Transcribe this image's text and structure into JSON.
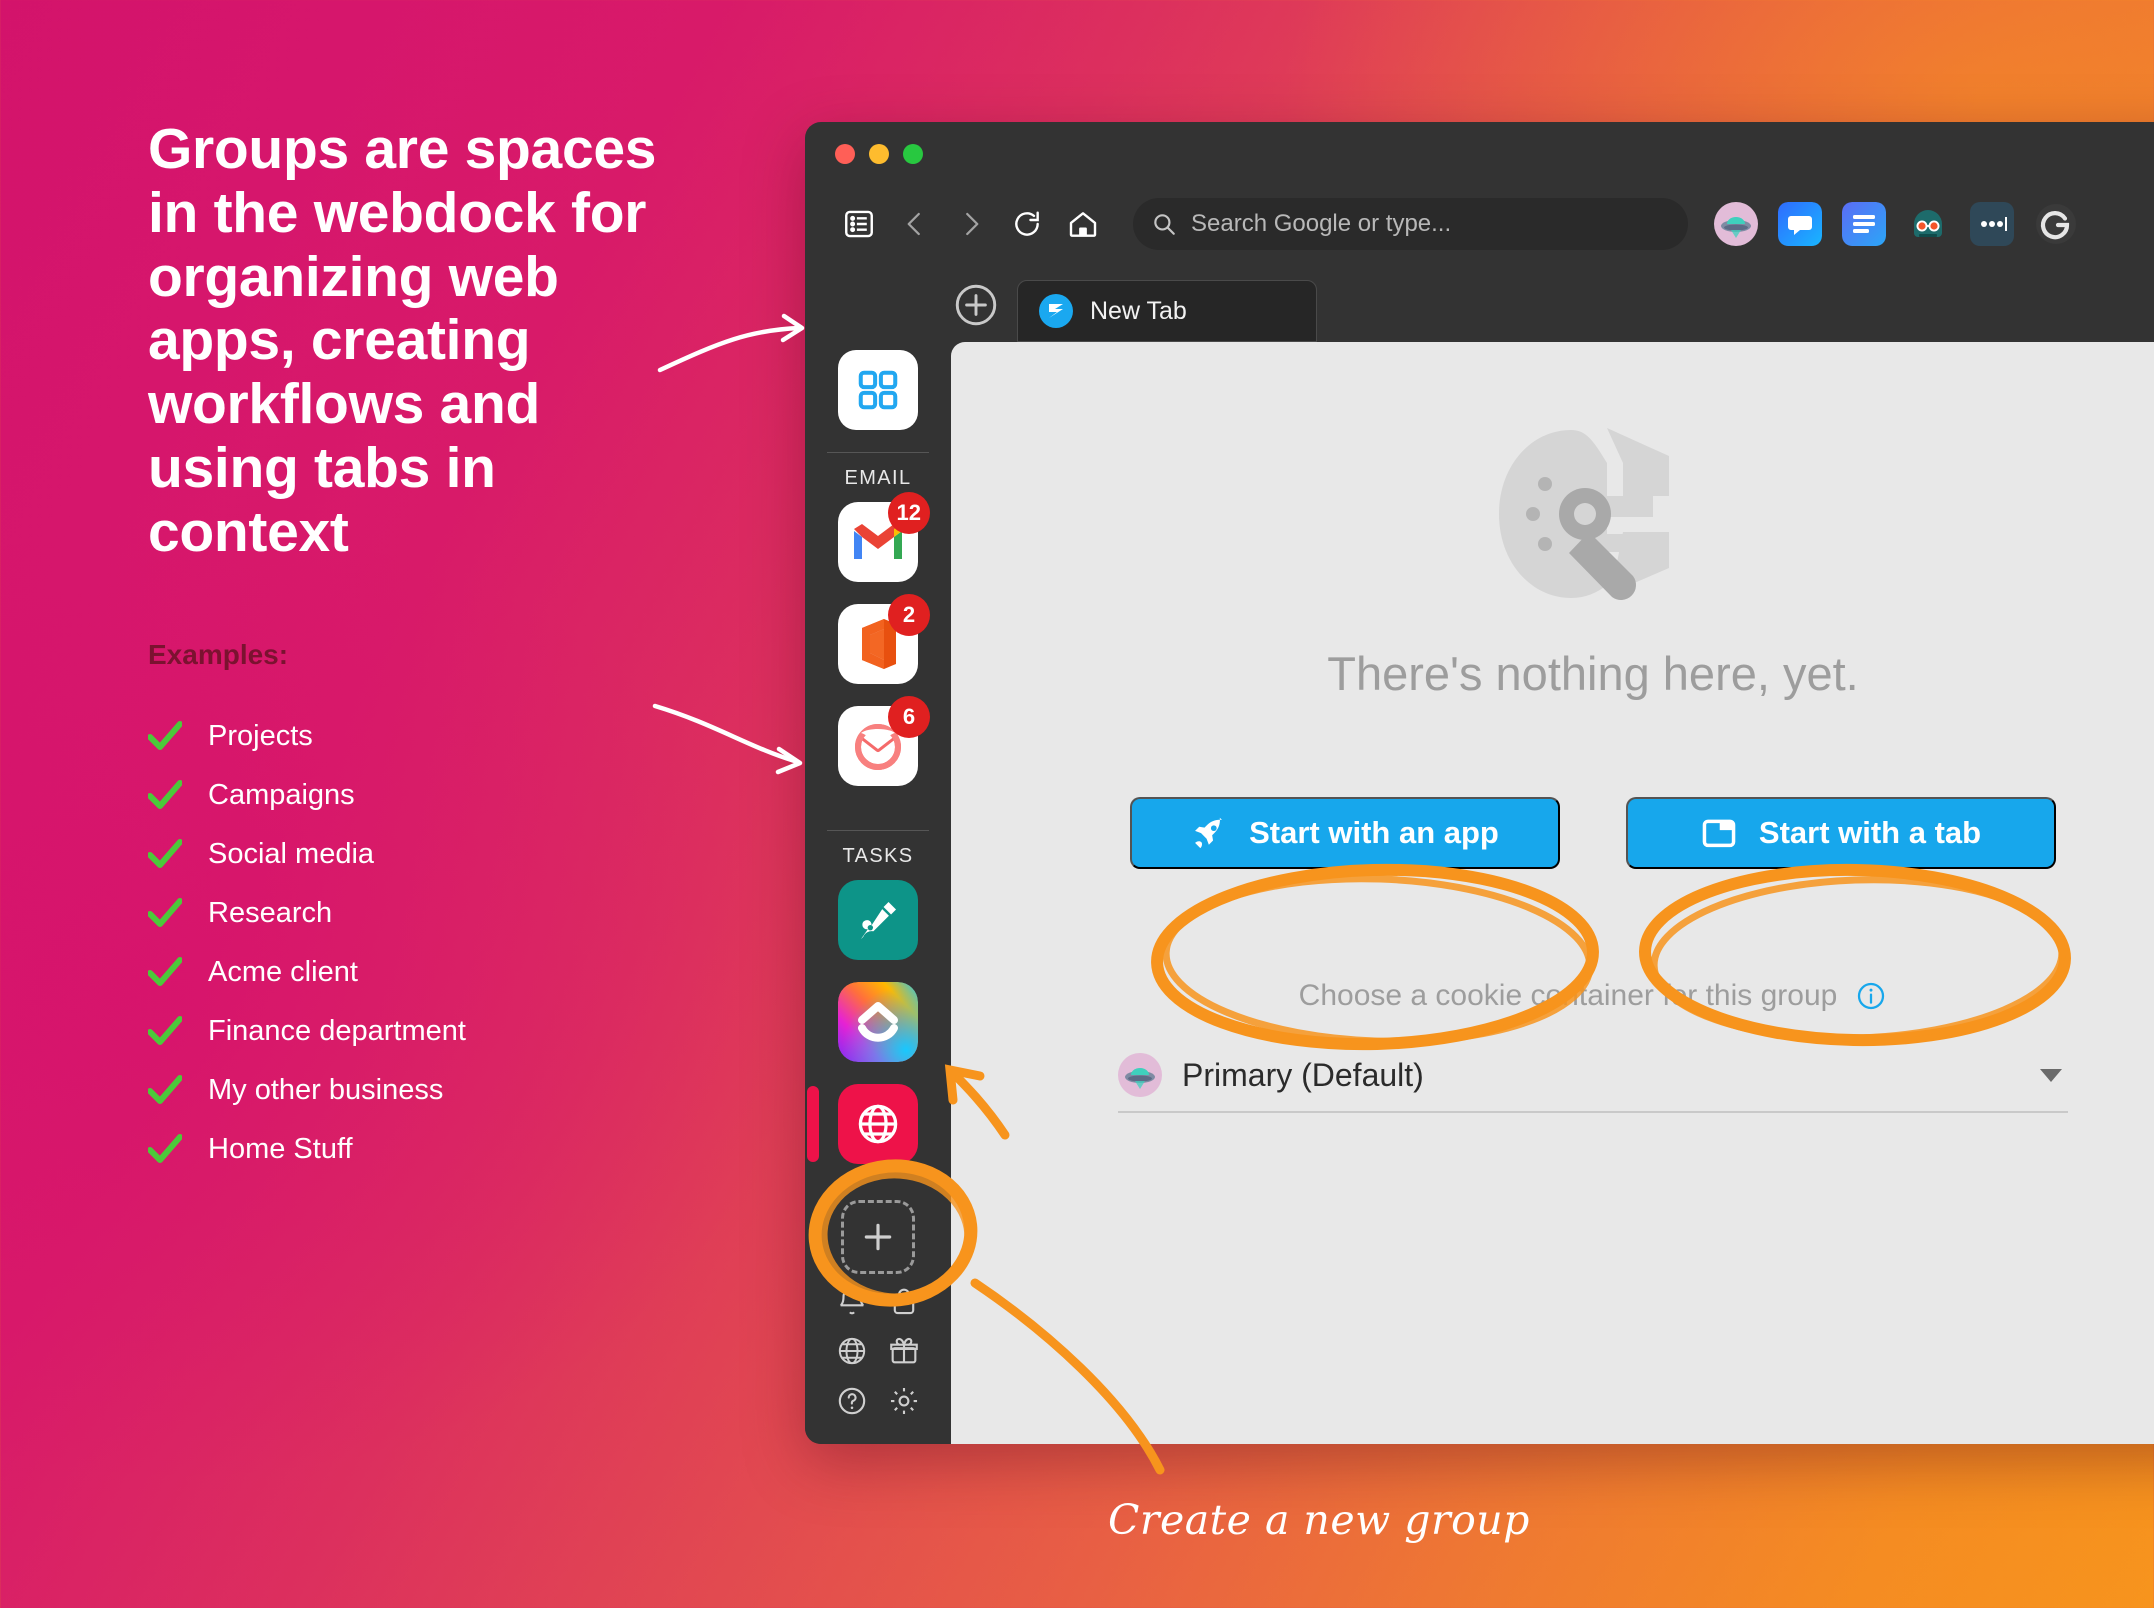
{
  "promo": {
    "headline": "Groups are spaces in the webdock for organizing web apps, creating workflows and using tabs in context",
    "examples_label": "Examples:",
    "examples": [
      "Projects",
      "Campaigns",
      "Social media",
      "Research",
      "Acme client",
      "Finance department",
      "My other business",
      "Home Stuff"
    ],
    "check_color": "#4CC93A",
    "headline_color": "#FFFFFF",
    "examples_label_color": "#7B1230"
  },
  "annotations": {
    "create_group_caption": "Create a new group",
    "highlight_color": "#F7941D"
  },
  "browser": {
    "titlebar": {
      "traffic_lights": [
        "close-button",
        "minimize-button",
        "maximize-button"
      ],
      "right_icon": "globe-icon"
    },
    "toolbar": {
      "buttons": [
        "sidebar-toggle-icon",
        "back-icon",
        "forward-icon",
        "reload-icon",
        "home-icon"
      ],
      "search_placeholder": "Search Google or type...",
      "search_value": "",
      "search_icon": "search-icon",
      "extensions": [
        "ufo-avatar-icon",
        "chat-bubble-icon",
        "reader-lines-icon",
        "glasses-bot-icon",
        "password-dots-icon",
        "grammarly-g-icon"
      ]
    },
    "tabs": {
      "new_tab_button": "plus-circle-icon",
      "items": [
        {
          "title": "New Tab",
          "favicon": "shift-logo-icon",
          "active": true
        }
      ]
    },
    "webdock": {
      "group_tile_icon": "grid-squares-icon",
      "sections": [
        {
          "label": "EMAIL",
          "apps": [
            {
              "name": "gmail-app-icon",
              "badge": "12"
            },
            {
              "name": "office-app-icon",
              "badge": "2"
            },
            {
              "name": "outlook-mail-app-icon",
              "badge": "6"
            }
          ]
        },
        {
          "label": "TASKS",
          "apps": [
            {
              "name": "pen-nib-app-icon",
              "badge": ""
            },
            {
              "name": "clickup-app-icon",
              "badge": ""
            },
            {
              "name": "web-globe-app-icon",
              "badge": "",
              "active": true
            }
          ]
        }
      ],
      "add_group_button": "plus-icon",
      "footer_icons": [
        "bell-icon",
        "lock-icon",
        "globe-icon",
        "gift-icon",
        "help-circle-icon",
        "gear-icon"
      ]
    },
    "content": {
      "hero_icon": "shift-mascot-icon",
      "empty_state_text": "There's nothing here, yet.",
      "primary_buttons": [
        {
          "label": "Start with an app",
          "icon": "rocket-icon"
        },
        {
          "label": "Start with a tab",
          "icon": "folder-tab-icon"
        }
      ],
      "cookie_hint": "Choose a cookie container for this group",
      "cookie_info_icon": "info-circle-icon",
      "cookie_selected": "Primary (Default)",
      "cookie_avatar": "ufo-avatar-icon",
      "cookie_caret": "chevron-down-icon",
      "button_color": "#17A7EC"
    }
  }
}
